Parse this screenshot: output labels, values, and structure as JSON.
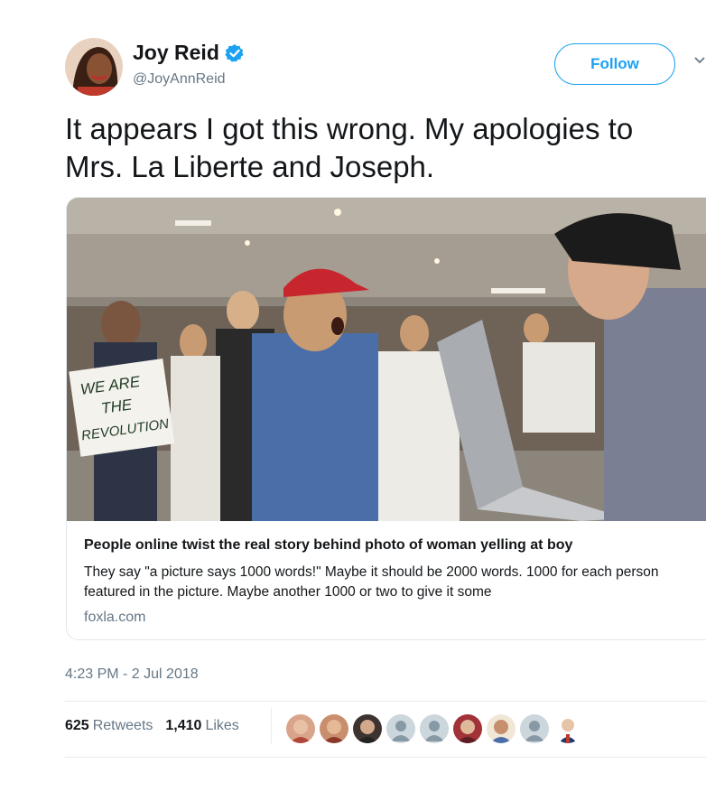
{
  "user": {
    "display_name": "Joy Reid",
    "handle": "@JoyAnnReid",
    "verified": true
  },
  "follow_label": "Follow",
  "tweet": {
    "text": "It appears I got this wrong. My apologies to Mrs. La Liberte and Joseph.",
    "timestamp": "4:23 PM - 2 Jul 2018"
  },
  "card": {
    "title": "People online twist the real story behind photo of woman yelling at boy",
    "description": "They say \"a picture says 1000 words!\" Maybe it should be 2000 words. 1000 for each person featured in the picture. Maybe another 1000 or two to give it some",
    "domain": "foxla.com",
    "photo_sign_text": "WE ARE THE REVOLUTION"
  },
  "stats": {
    "retweets_count": "625",
    "retweets_label": "Retweets",
    "likes_count": "1,410",
    "likes_label": "Likes"
  },
  "colors": {
    "accent": "#1da1f2",
    "secondary_text": "#657786",
    "border": "#e1e8ed"
  },
  "icons": [
    "verified-badge-icon",
    "chevron-down-icon"
  ]
}
